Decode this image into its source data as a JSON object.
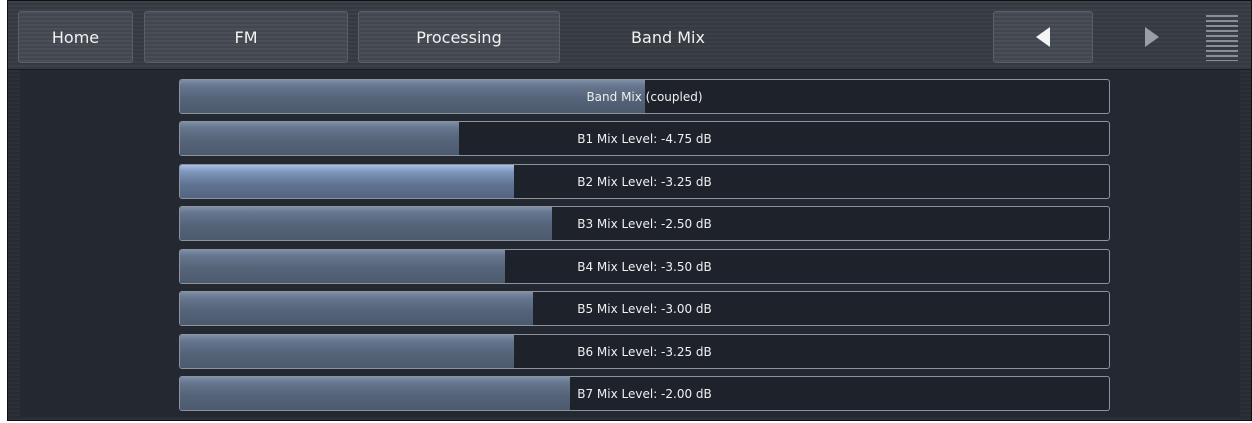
{
  "nav": {
    "home": "Home",
    "fm": "FM",
    "processing": "Processing",
    "current": "Band Mix",
    "prev_icon": "triangle-left-icon",
    "next_icon": "triangle-right-icon",
    "menu_icon": "menu-lines-icon"
  },
  "sliders": [
    {
      "label": "Band Mix (coupled)",
      "level": 0.5,
      "selected": false
    },
    {
      "label": "B1 Mix Level: -4.75 dB",
      "level": 0.3,
      "selected": false
    },
    {
      "label": "B2 Mix Level: -3.25 dB",
      "level": 0.36,
      "selected": true
    },
    {
      "label": "B3 Mix Level: -2.50 dB",
      "level": 0.4,
      "selected": false
    },
    {
      "label": "B4 Mix Level: -3.50 dB",
      "level": 0.35,
      "selected": false
    },
    {
      "label": "B5 Mix Level: -3.00 dB",
      "level": 0.38,
      "selected": false
    },
    {
      "label": "B6 Mix Level: -3.25 dB",
      "level": 0.36,
      "selected": false
    },
    {
      "label": "B7 Mix Level: -2.00 dB",
      "level": 0.42,
      "selected": false
    }
  ],
  "colors": {
    "fill": "#5a6a80",
    "selected_fill": "#7f97bd",
    "track": "#1e222b"
  }
}
